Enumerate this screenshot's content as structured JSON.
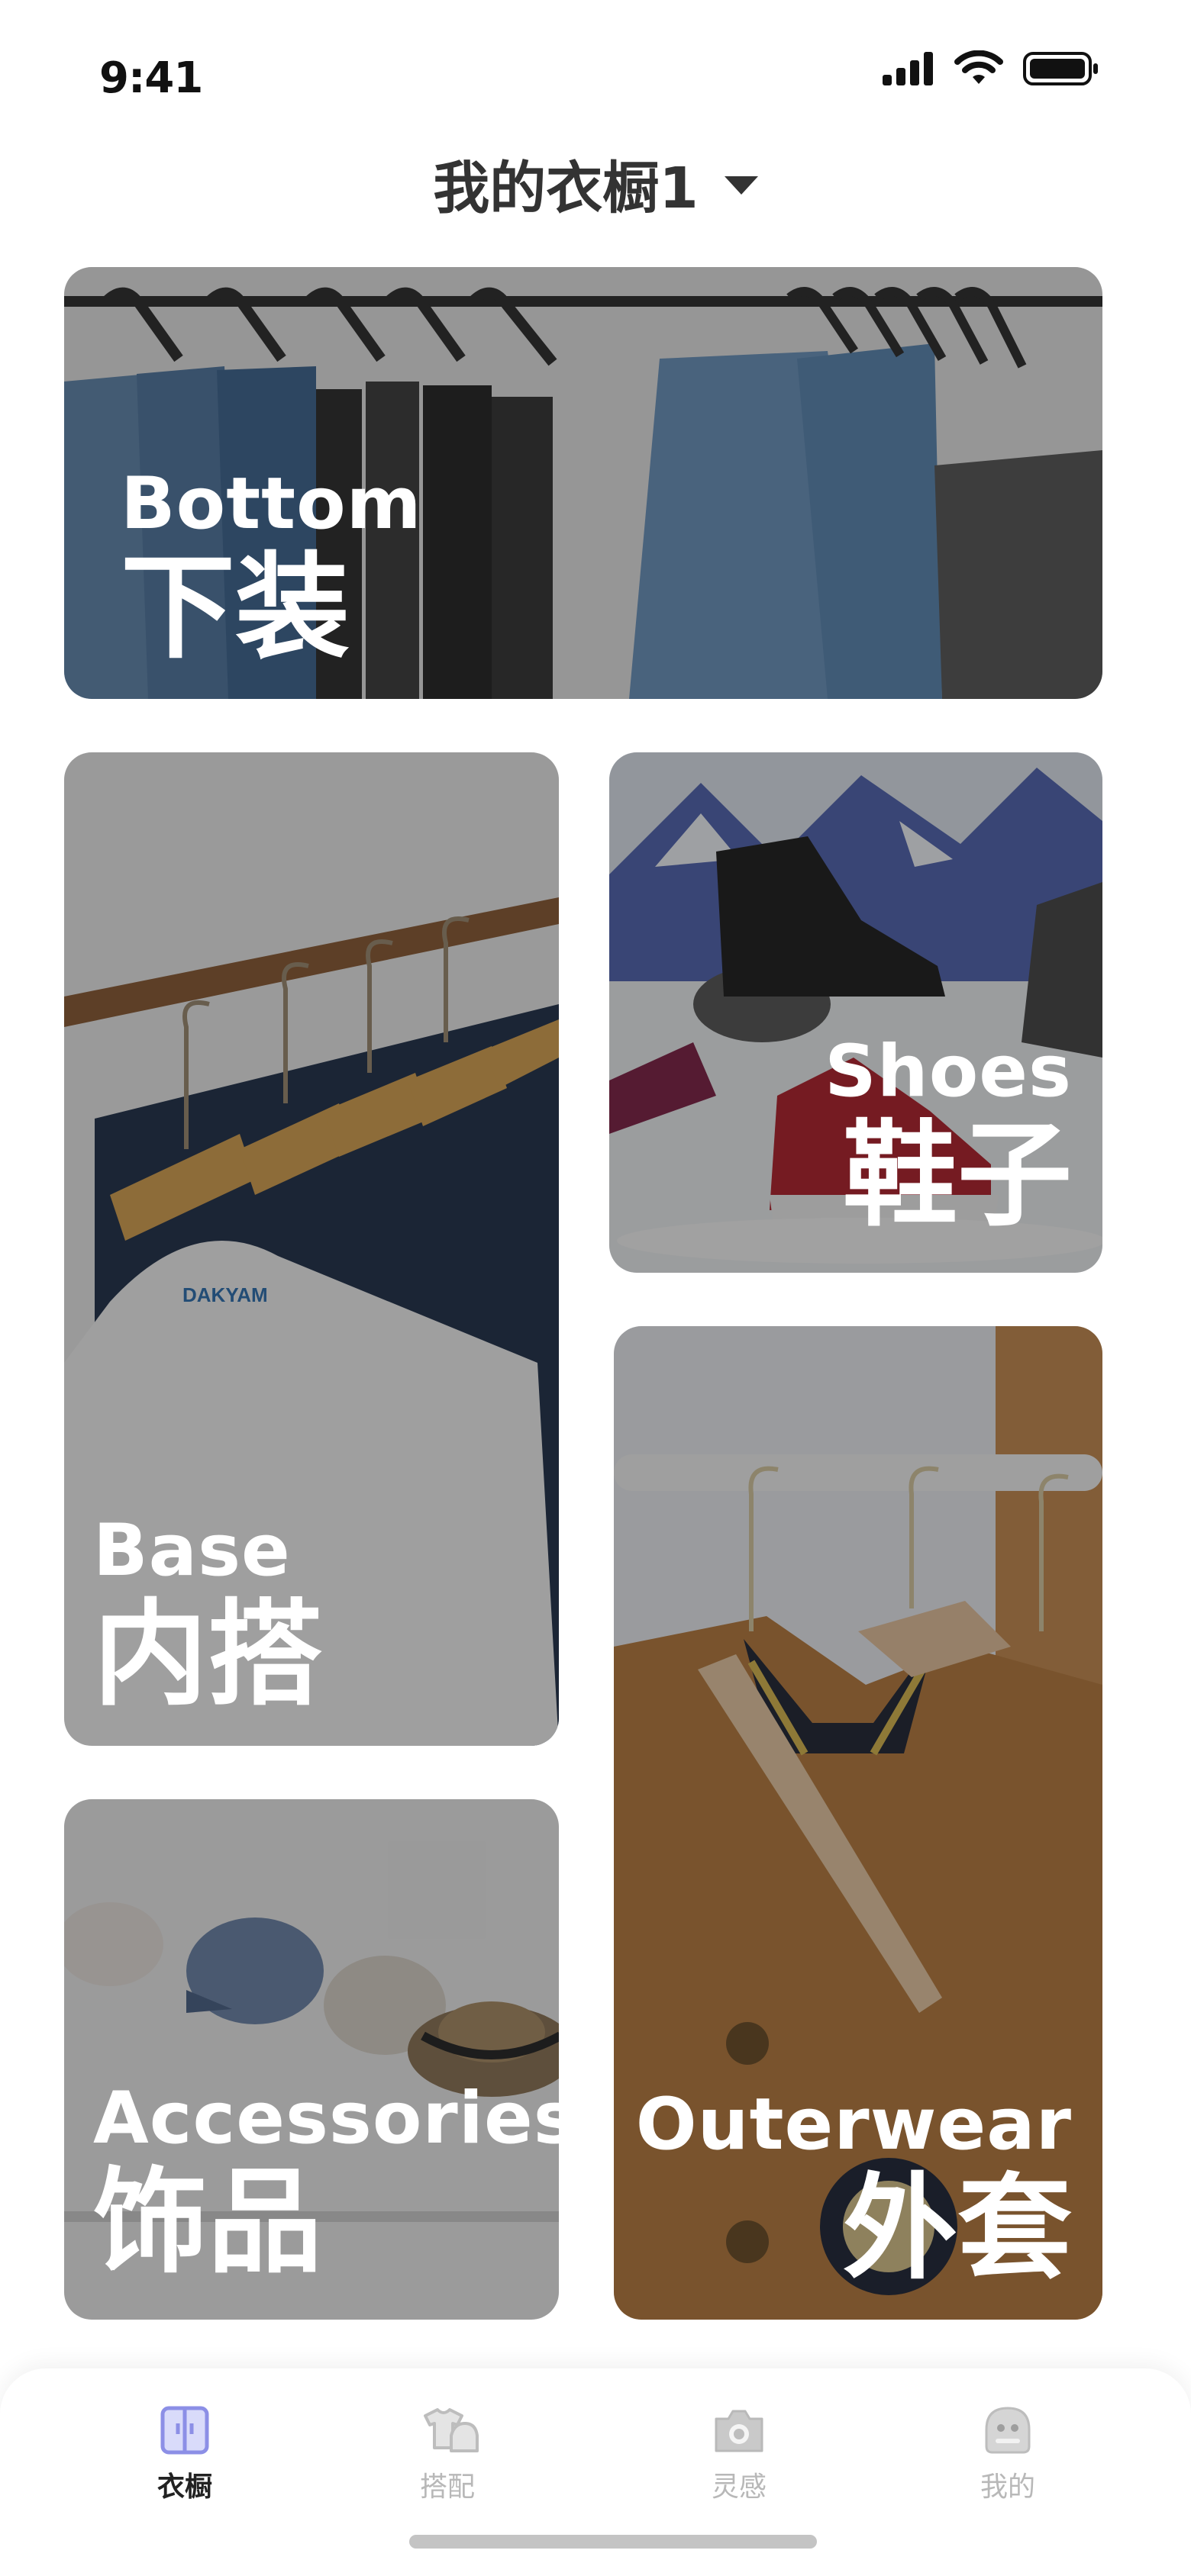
{
  "status_bar": {
    "time": "9:41"
  },
  "header": {
    "title": "我的衣橱1"
  },
  "categories": {
    "bottom": {
      "en": "Bottom",
      "zh": "下装"
    },
    "base": {
      "en": "Base",
      "zh": "内搭"
    },
    "shoes": {
      "en": "Shoes",
      "zh": "鞋子"
    },
    "accessories": {
      "en": "Accessories",
      "zh": "饰品"
    },
    "outerwear": {
      "en": "Outerwear",
      "zh": "外套"
    }
  },
  "tabs": [
    {
      "label": "衣橱",
      "icon": "wardrobe-icon",
      "active": true
    },
    {
      "label": "搭配",
      "icon": "outfit-icon",
      "active": false
    },
    {
      "label": "灵感",
      "icon": "camera-icon",
      "active": false
    },
    {
      "label": "我的",
      "icon": "profile-icon",
      "active": false
    }
  ],
  "colors": {
    "accent": "#8c8fe6",
    "inactive": "#b8b8b8",
    "overlay": "rgba(20,20,20,0.38)"
  }
}
